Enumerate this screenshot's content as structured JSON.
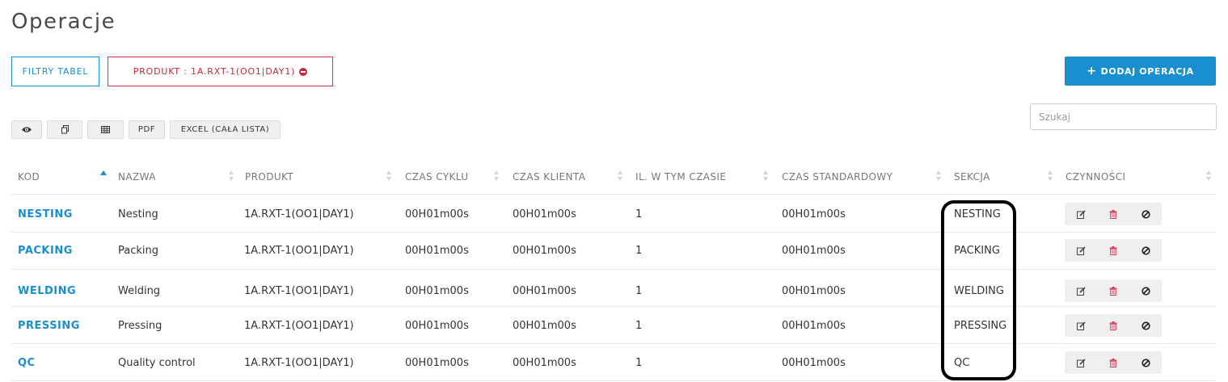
{
  "page": {
    "title": "Operacje"
  },
  "toolbar": {
    "filters_label": "FILTRY TABEL",
    "active_filter_label": "PRODUKT : 1A.RXT-1(OO1|DAY1)",
    "add_label": "DODAJ OPERACJA",
    "add_icon": "plus-icon",
    "pdf_label": "PDF",
    "excel_label": "EXCEL (CAŁA LISTA)",
    "visibility_icon": "eye-icon",
    "copy_icon": "copy-icon",
    "csv_icon": "table-icon"
  },
  "search": {
    "placeholder": "Szukaj",
    "value": ""
  },
  "table": {
    "columns": [
      "KOD",
      "NAZWA",
      "PRODUKT",
      "CZAS CYKLU",
      "CZAS KLIENTA",
      "IL. W TYM CZASIE",
      "CZAS STANDARDOWY",
      "SEKCJA",
      "CZYNNOŚCI"
    ],
    "sorted_column": "KOD",
    "sort_direction": "asc",
    "rows": [
      {
        "code": "NESTING",
        "name": "Nesting",
        "product": "1A.RXT-1(OO1|DAY1)",
        "cycle_time": "00H01m00s",
        "client_time": "00H01m00s",
        "qty": "1",
        "standard_time": "00H01m00s",
        "section": "NESTING"
      },
      {
        "code": "PACKING",
        "name": "Packing",
        "product": "1A.RXT-1(OO1|DAY1)",
        "cycle_time": "00H01m00s",
        "client_time": "00H01m00s",
        "qty": "1",
        "standard_time": "00H01m00s",
        "section": "PACKING"
      },
      {
        "code": "WELDING",
        "name": "Welding",
        "product": "1A.RXT-1(OO1|DAY1)",
        "cycle_time": "00H01m00s",
        "client_time": "00H01m00s",
        "qty": "1",
        "standard_time": "00H01m00s",
        "section": "WELDING"
      },
      {
        "code": "PRESSING",
        "name": "Pressing",
        "product": "1A.RXT-1(OO1|DAY1)",
        "cycle_time": "00H01m00s",
        "client_time": "00H01m00s",
        "qty": "1",
        "standard_time": "00H01m00s",
        "section": "PRESSING"
      },
      {
        "code": "QC",
        "name": "Quality control",
        "product": "1A.RXT-1(OO1|DAY1)",
        "cycle_time": "00H01m00s",
        "client_time": "00H01m00s",
        "qty": "1",
        "standard_time": "00H01m00s",
        "section": "QC"
      }
    ],
    "row_actions": [
      "edit-icon",
      "delete-icon",
      "disable-icon"
    ]
  },
  "colors": {
    "accent": "#1a8fd0",
    "danger": "#c9263d",
    "highlight_border": "#000000"
  }
}
